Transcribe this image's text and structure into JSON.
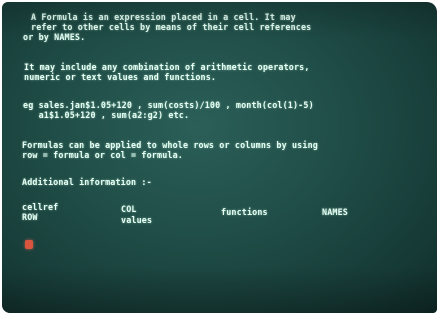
{
  "screen": {
    "help_lines": [
      "A Formula is an expression placed in a cell. It may",
      "refer to other cells by means of their cell references",
      "or by NAMES.",
      "It may include any combination of arithmetic operators,",
      "numeric or text values and functions.",
      "eg sales.jan$1.05+120 , sum(costs)/100 , month(col(1)-5)",
      "   a1$1.05+120 , sum(a2:g2) etc.",
      "Formulas can be applied to whole rows or columns by using",
      "row = formula or col = formula.",
      "Additional information :-"
    ],
    "topics": {
      "cellref": "cellref",
      "row": "ROW",
      "col": "COL",
      "values": "values",
      "functions": "functions",
      "names": "NAMES"
    }
  },
  "colors": {
    "screen_bg": "#1f4c46",
    "text": "#e7fff4",
    "cursor": "#d8553f"
  }
}
